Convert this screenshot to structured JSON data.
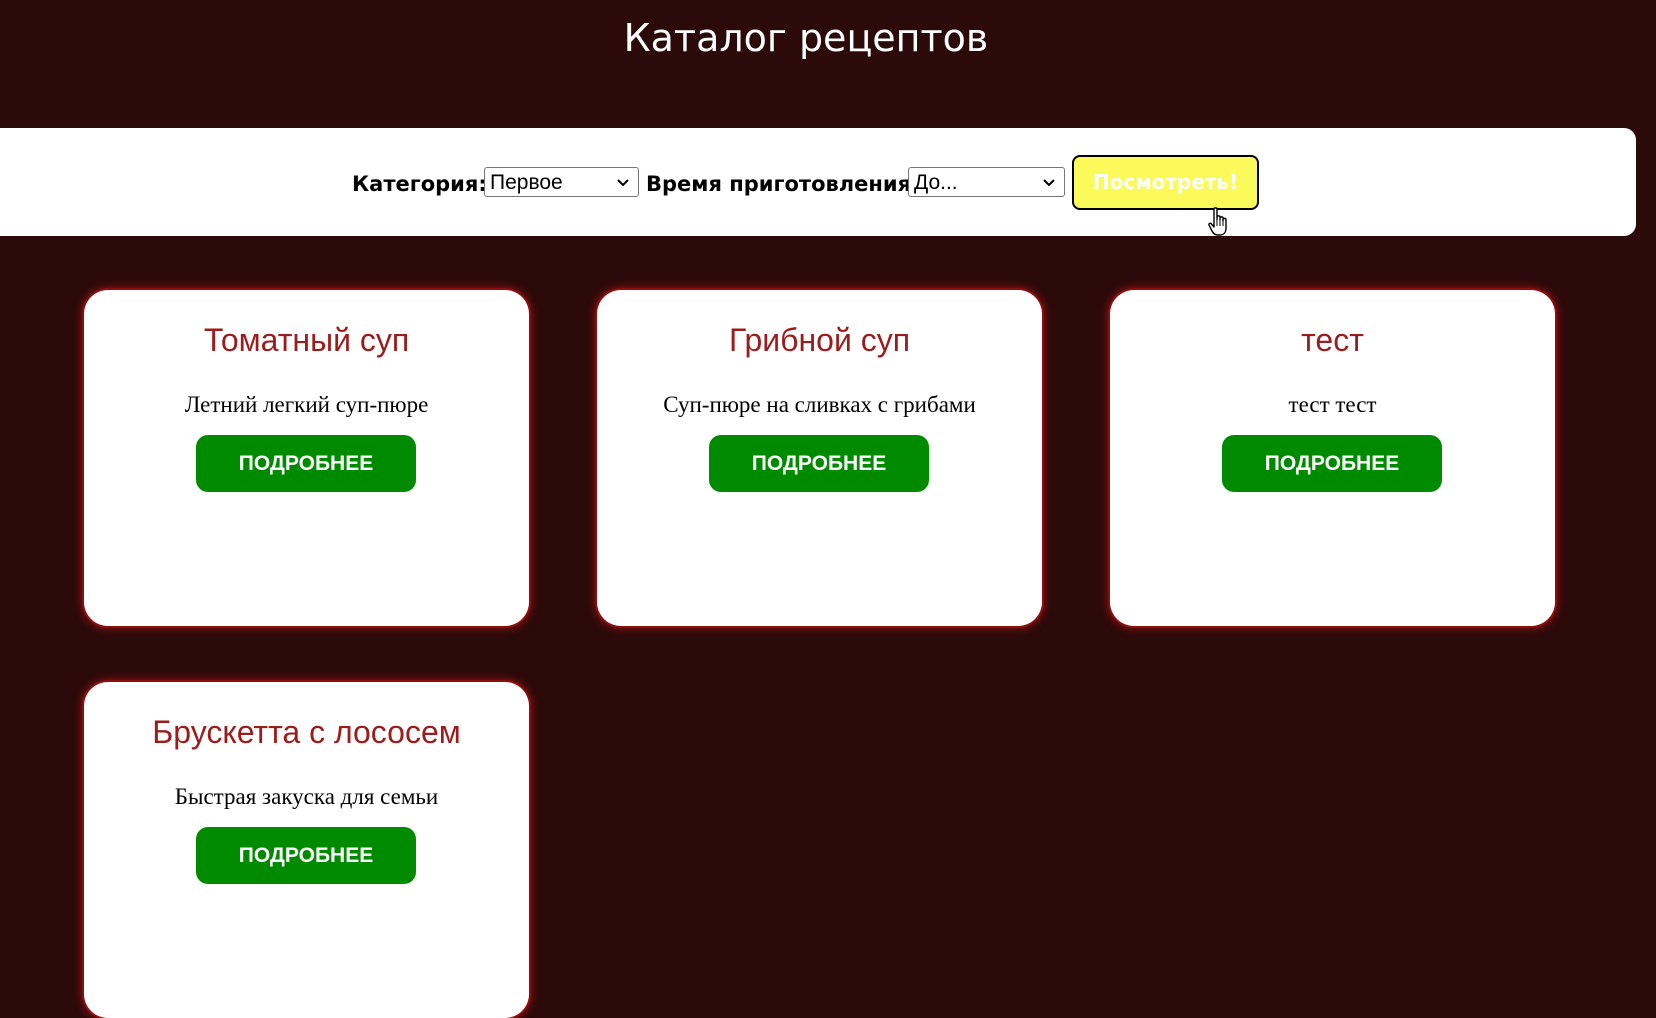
{
  "header": {
    "title": "Каталог рецептов"
  },
  "filters": {
    "category_label": "Категория:",
    "category_value": "Первое",
    "time_label": "Время приготовления:",
    "time_value": "До...",
    "submit_label": "Посмотреть!"
  },
  "recipes": [
    {
      "title": "Томатный суп",
      "description": "Летний легкий суп-пюре",
      "button": "ПОДРОБНЕЕ"
    },
    {
      "title": "Грибной суп",
      "description": "Суп-пюре на сливках с грибами",
      "button": "ПОДРОБНЕЕ"
    },
    {
      "title": "тест",
      "description": "тест тест",
      "button": "ПОДРОБНЕЕ"
    },
    {
      "title": "Брускетта с лососем",
      "description": "Быстрая закуска для семьи",
      "button": "ПОДРОБНЕЕ"
    }
  ],
  "colors": {
    "background": "#2c0a0a",
    "card_title": "#9b1c1c",
    "details_button": "#008a00",
    "view_button": "#fafa5a"
  },
  "icons": {
    "select_arrow": "chevron-down-icon",
    "cursor": "hand-pointer-icon"
  }
}
